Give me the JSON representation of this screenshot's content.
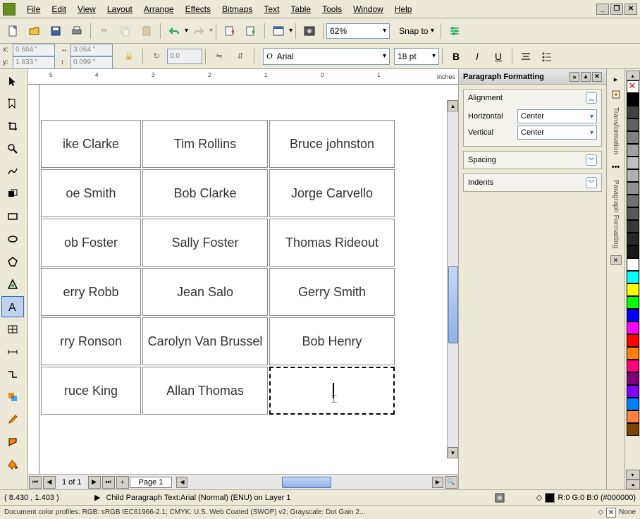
{
  "menu": {
    "file": "File",
    "edit": "Edit",
    "view": "View",
    "layout": "Layout",
    "arrange": "Arrange",
    "effects": "Effects",
    "bitmaps": "Bitmaps",
    "text": "Text",
    "table": "Table",
    "tools": "Tools",
    "window": "Window",
    "help": "Help"
  },
  "zoom": "62%",
  "snap": "Snap to",
  "coords": {
    "x": "0.664 \"",
    "y": "1.633 \"",
    "w": "3.064 \"",
    "h": "0.099 \"",
    "angle": "0.0"
  },
  "font": {
    "name": "Arial",
    "size": "18 pt"
  },
  "ruler_label": "inches",
  "table": {
    "rows": [
      [
        "ike Clarke",
        "Tim Rollins",
        "Bruce johnston"
      ],
      [
        "oe Smith",
        "Bob Clarke",
        "Jorge Carvello"
      ],
      [
        "ob Foster",
        "Sally Foster",
        "Thomas Rideout"
      ],
      [
        "erry Robb",
        "Jean Salo",
        "Gerry Smith"
      ],
      [
        "rry Ronson",
        "Carolyn Van Brussel",
        "Bob Henry"
      ],
      [
        "ruce King",
        "Allan Thomas",
        ""
      ]
    ]
  },
  "page_nav": {
    "label": "1 of 1",
    "tab": "Page 1"
  },
  "docker": {
    "title": "Paragraph Formatting",
    "alignment": {
      "title": "Alignment",
      "h_label": "Horizontal",
      "h_value": "Center",
      "v_label": "Vertical",
      "v_value": "Center"
    },
    "spacing": "Spacing",
    "indents": "Indents"
  },
  "right_panel_label": "Transformation",
  "right_panel_label2": "Paragraph Formatting",
  "status": {
    "coord": "( 8.430 , 1.403 )",
    "context": "Child Paragraph Text:Arial (Normal) (ENU) on Layer 1",
    "fill": "R:0 G:0 B:0 (#000000)",
    "profiles": "Document color profiles: RGB: sRGB IEC61966-2.1; CMYK: U.S. Web Coated (SWOP) v2; Grayscale: Dot Gain 2...",
    "none": "None"
  },
  "palette": [
    "#000000",
    "#ffffff",
    "#808080",
    "#c0c0c0",
    "#a0a0a0",
    "#606060",
    "#404040",
    "#00ffff",
    "#ffff00",
    "#00ff00",
    "#ff00ff",
    "#ff8000",
    "#ff0080",
    "#0080ff"
  ]
}
